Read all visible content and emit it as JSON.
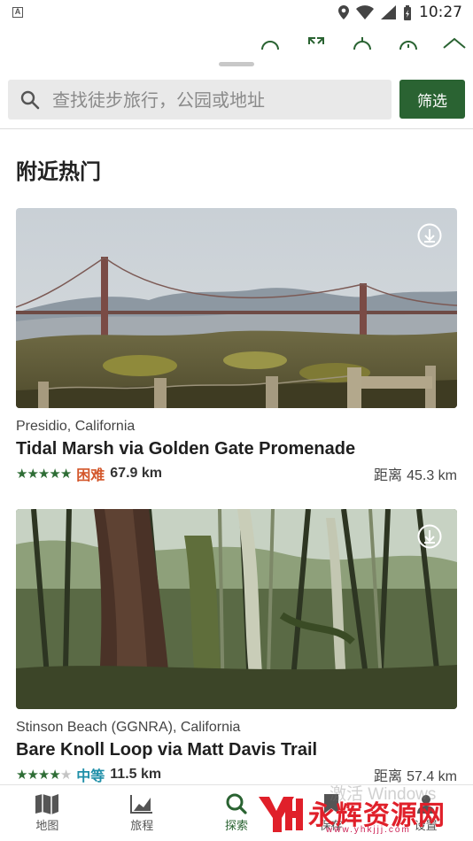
{
  "status_bar": {
    "time": "10:27",
    "notification_icon": "A"
  },
  "map_toolbar": {
    "icons": [
      "map-tool-1-icon",
      "expand-icon",
      "layers-icon",
      "compass-icon",
      "map-tool-5-icon"
    ]
  },
  "search": {
    "placeholder": "查找徒步旅行，公园或地址",
    "value": ""
  },
  "filter_button": {
    "label": "筛选"
  },
  "section": {
    "title": "附近热门"
  },
  "trails": [
    {
      "location": "Presidio, California",
      "name": "Tidal Marsh via Golden Gate Promenade",
      "rating": 5,
      "difficulty": "困难",
      "difficulty_color": "#d3562a",
      "length": "67.9 km",
      "distance_label": "距离",
      "distance": "45.3 km"
    },
    {
      "location": "Stinson Beach (GGNRA), California",
      "name": "Bare Knoll Loop via Matt Davis Trail",
      "rating": 4,
      "difficulty": "中等",
      "difficulty_color": "#1f8fa8",
      "length": "11.5 km",
      "distance_label": "距离",
      "distance": "57.4 km"
    }
  ],
  "bottom_nav": {
    "items": [
      {
        "label": "地图",
        "icon": "map-icon"
      },
      {
        "label": "旅程",
        "icon": "chart-icon"
      },
      {
        "label": "探索",
        "icon": "search-icon",
        "active": true
      },
      {
        "label": "保存",
        "icon": "bookmark-icon"
      },
      {
        "label": "设置",
        "icon": "person-icon"
      }
    ]
  },
  "colors": {
    "brand_green": "#2a6332",
    "star": "#2e6d35"
  },
  "watermark": {
    "text": "永辉资源网",
    "url": "www.yhkjjj.com",
    "windows_text": "激活 Windows"
  }
}
